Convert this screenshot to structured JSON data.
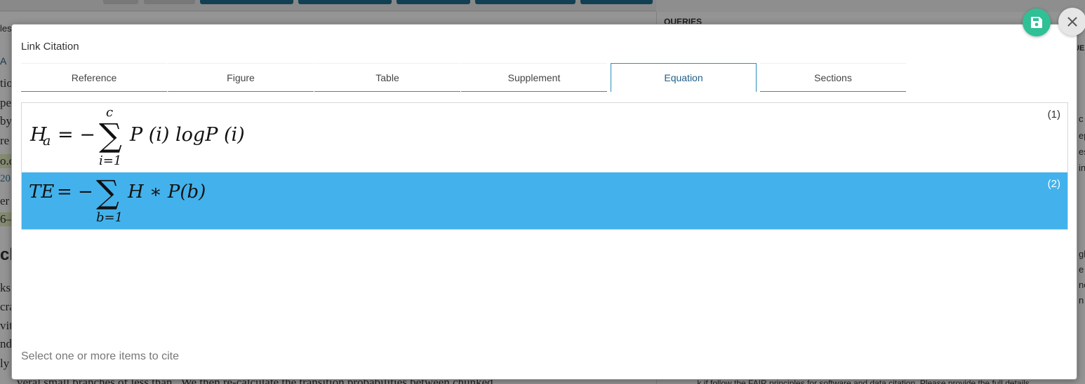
{
  "background": {
    "queries_label": "QUERIES",
    "left_fragments": [
      "les",
      "A",
      "tio",
      "pe",
      "by",
      "re",
      "o.d",
      "20",
      "er",
      "6–",
      "ch",
      "ks",
      "cra",
      "vit",
      "nd",
      "ly"
    ],
    "right_fragments": [
      "c i",
      "ep",
      "es",
      "in",
      "gh",
      "e I",
      "no",
      "n",
      "UE"
    ],
    "bottom_text": "veral small branches of less than   . We then re-calculate the transition probabilities between chunked",
    "right_bottom_text": "... k if follow the FAIR principles for software and data citation. Please provide the full details"
  },
  "modal": {
    "title": "Link Citation",
    "tabs": [
      {
        "label": "Reference",
        "active": false
      },
      {
        "label": "Figure",
        "active": false
      },
      {
        "label": "Table",
        "active": false
      },
      {
        "label": "Supplement",
        "active": false
      },
      {
        "label": "Equation",
        "active": true
      },
      {
        "label": "Sections",
        "active": false
      }
    ],
    "equations": [
      {
        "number": "(1)",
        "selected": false,
        "lhs": "H",
        "lhs_sub": "a",
        "sum_upper": "c",
        "sum_lower": "i=1",
        "body": "P (i) logP (i)"
      },
      {
        "number": "(2)",
        "selected": true,
        "lhs": "TE",
        "sum_lower": "b=1",
        "body": "H ∗ P(b)"
      }
    ],
    "footer_hint": "Select one or more items to cite"
  },
  "actions": {
    "save_icon": "floppy-disk-icon",
    "close_icon": "close-icon"
  },
  "colors": {
    "accent": "#2a8fbd",
    "selected_row": "#43b2ec",
    "save_button": "#2fc096",
    "close_button": "#e6e6e6"
  }
}
